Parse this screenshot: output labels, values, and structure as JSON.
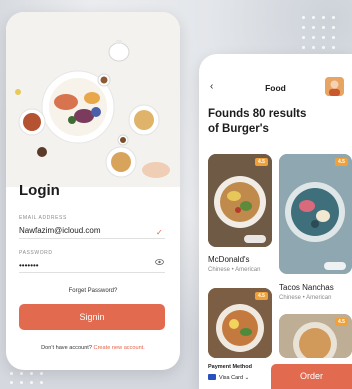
{
  "login": {
    "title": "Login",
    "email_label": "EMAIL ADDRESS",
    "email_value": "Nawfazim@icloud.com",
    "password_label": "PASSWORD",
    "password_value": "•••••••",
    "forgot": "Forget Password?",
    "signin": "Signin",
    "no_account": "Don't have account?",
    "create_link": "Create new account."
  },
  "food": {
    "back_glyph": "‹",
    "title": "Food",
    "results_line1": "Founds 80 results",
    "results_line2": "of Burger's",
    "cards": [
      {
        "rating": "4.5",
        "name": "McDonald's",
        "sub": "Chinese • American"
      },
      {
        "rating": "4.5",
        "name": "Tacos Nanchas",
        "sub": "Chinese • American"
      },
      {
        "rating": "4.5"
      },
      {
        "rating": "4.5"
      }
    ],
    "payment_label": "Payment Method",
    "payment_value": "Visa Card",
    "payment_chevron": "⌄",
    "order": "Order"
  },
  "colors": {
    "accent": "#e26a4f",
    "rating": "#f0a13a"
  },
  "icons": [
    "check-icon",
    "eye-icon",
    "back-icon",
    "avatar-image",
    "camera-icon",
    "card-icon"
  ]
}
